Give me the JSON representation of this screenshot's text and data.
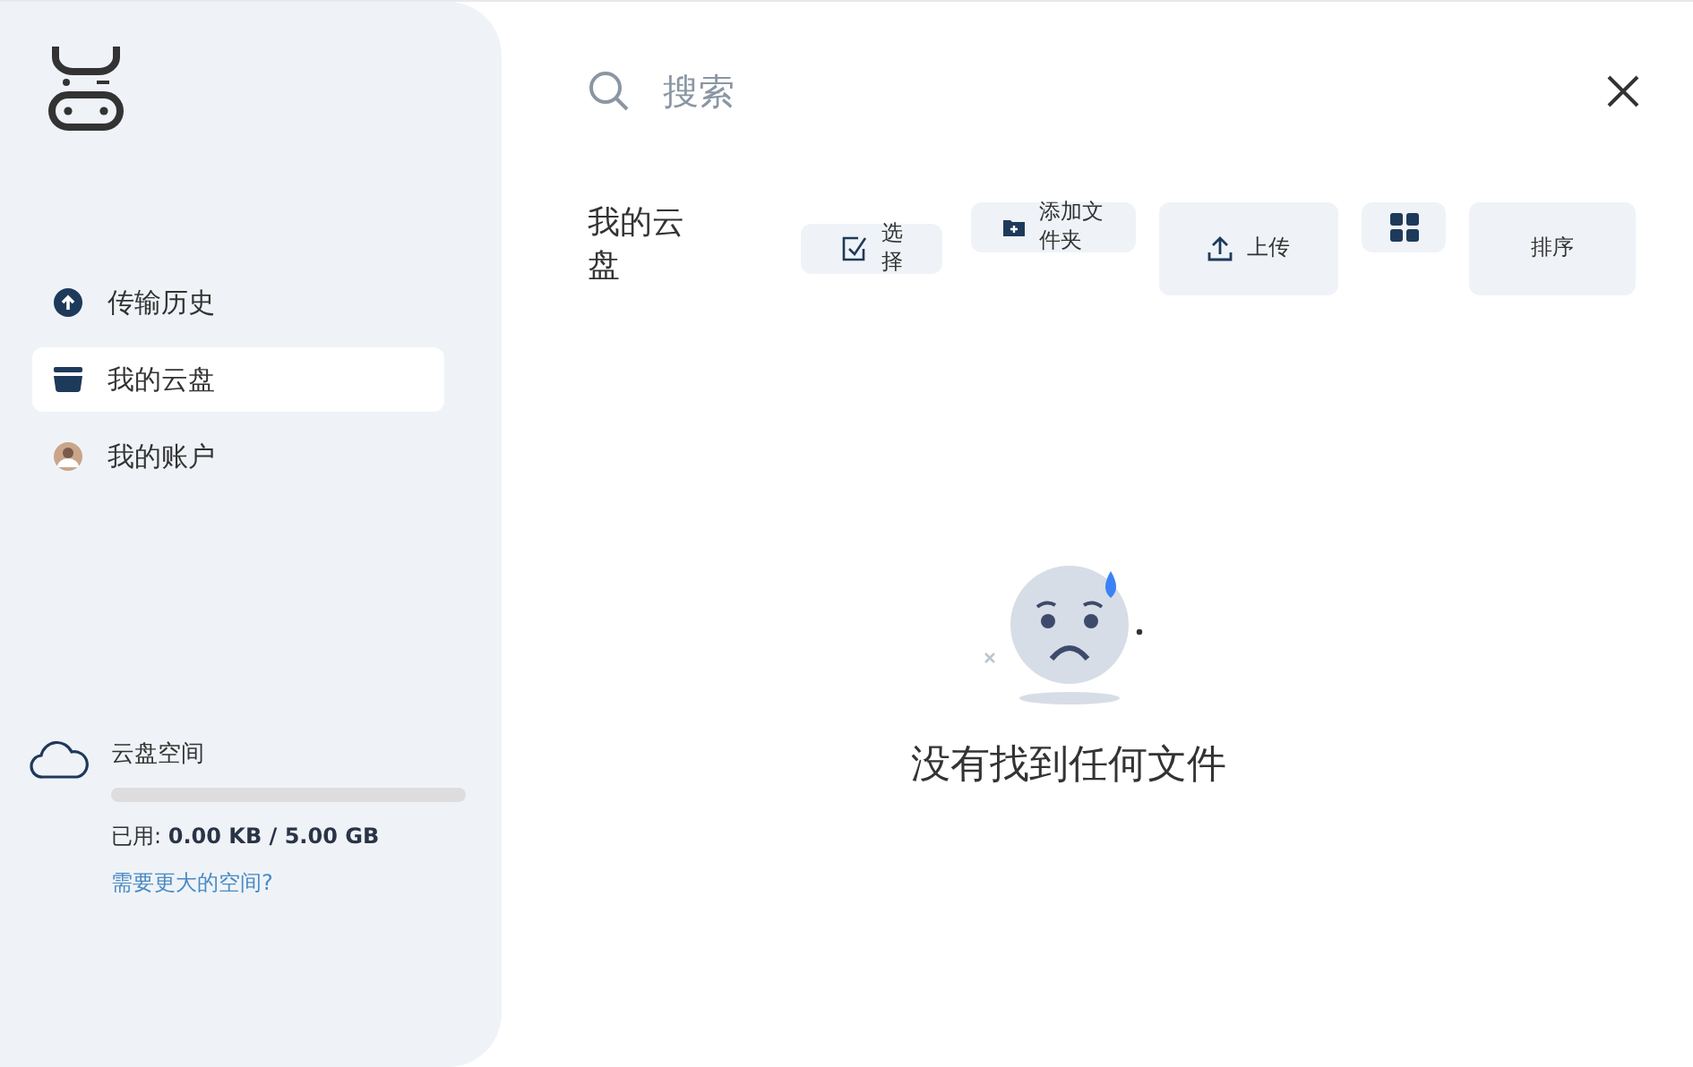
{
  "sidebar": {
    "items": [
      {
        "label": "传输历史",
        "kind": "upload",
        "selected": false
      },
      {
        "label": "我的云盘",
        "kind": "drive",
        "selected": true
      },
      {
        "label": "我的账户",
        "kind": "avatar",
        "selected": false
      }
    ],
    "storage": {
      "title": "云盘空间",
      "level": 0,
      "used_label": "已用:",
      "used_value": "0.00 KB / 5.00 GB",
      "upgrade_link": "需要更大的空间?"
    }
  },
  "search": {
    "placeholder": "搜索"
  },
  "toolbar": {
    "title": "我的云盘",
    "buttons": [
      {
        "kind": "select",
        "label": "选择"
      },
      {
        "kind": "folder",
        "label": "添加文件夹"
      },
      {
        "kind": "upload",
        "label": "上传"
      },
      {
        "kind": "grid"
      },
      {
        "kind": "sort",
        "label": "排序"
      }
    ]
  },
  "empty_state": {
    "message": "没有找到任何文件"
  }
}
